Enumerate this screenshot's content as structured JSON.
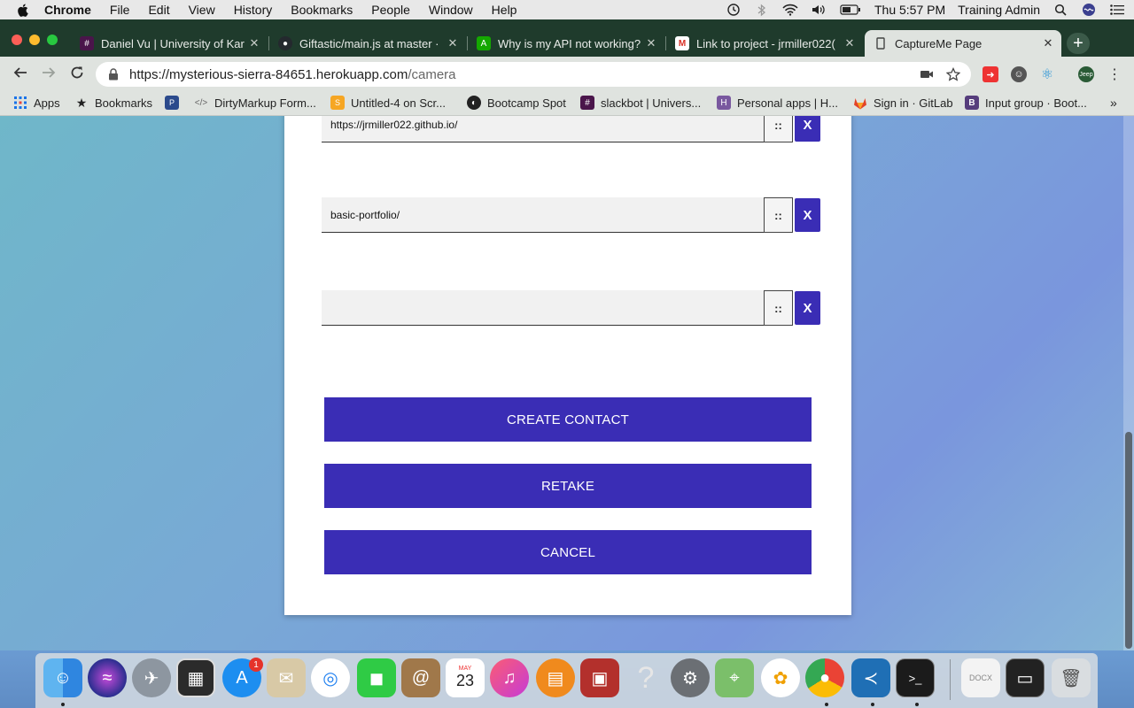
{
  "menubar": {
    "app": "Chrome",
    "items": [
      "File",
      "Edit",
      "View",
      "History",
      "Bookmarks",
      "People",
      "Window",
      "Help"
    ],
    "clock": "Thu 5:57 PM",
    "user": "Training Admin"
  },
  "tabs": [
    {
      "title": "Daniel Vu | University of Kar",
      "icon": "slack-icon",
      "color": "#4a154b"
    },
    {
      "title": "Giftastic/main.js at master ·",
      "icon": "github-icon",
      "color": "#24292e"
    },
    {
      "title": "Why is my API not working?",
      "icon": "upwork-icon",
      "color": "#14a800"
    },
    {
      "title": "Link to project - jrmiller022(",
      "icon": "gmail-icon",
      "color": "#d93025"
    },
    {
      "title": "CaptureMe Page",
      "icon": "page-icon",
      "color": "#555555",
      "active": true
    }
  ],
  "address": {
    "host": "https://mysterious-sierra-84651.herokuapp.com",
    "path": "/camera"
  },
  "bookmarks": [
    {
      "label": "Apps",
      "icon": "apps-grid-icon"
    },
    {
      "label": "Bookmarks",
      "icon": "star-icon"
    },
    {
      "label": "",
      "icon": "dropbox-paper-icon"
    },
    {
      "label": "DirtyMarkup Form...",
      "icon": "code-icon"
    },
    {
      "label": "Untitled-4 on Scr...",
      "icon": "scrimba-icon"
    },
    {
      "label": "Bootcamp Spot",
      "icon": "globe-icon"
    },
    {
      "label": "slackbot | Univers...",
      "icon": "slack-icon"
    },
    {
      "label": "Personal apps | H...",
      "icon": "heroku-icon"
    },
    {
      "label": "Sign in · GitLab",
      "icon": "gitlab-icon"
    },
    {
      "label": "Input group · Boot...",
      "icon": "bootstrap-icon"
    }
  ],
  "form": {
    "rows": [
      {
        "value": "https://jrmiller022.github.io/",
        "drag_label": "::",
        "delete_label": "X"
      },
      {
        "value": "basic-portfolio/",
        "drag_label": "::",
        "delete_label": "X"
      },
      {
        "value": "",
        "drag_label": "::",
        "delete_label": "X"
      }
    ],
    "create_label": "CREATE CONTACT",
    "retake_label": "RETAKE",
    "cancel_label": "CANCEL"
  },
  "dock": {
    "badge_count": "1",
    "calendar_month": "MAY",
    "calendar_day": "23"
  },
  "colors": {
    "accent": "#3a2db5",
    "tabstrip": "#1f3b2c"
  }
}
